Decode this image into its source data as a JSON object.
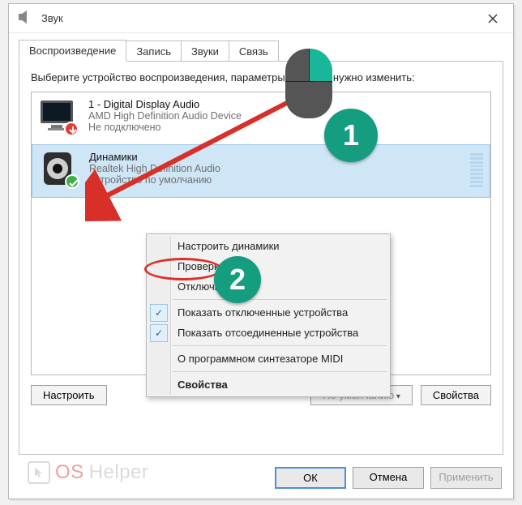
{
  "window": {
    "title": "Звук"
  },
  "tabs": [
    {
      "label": "Воспроизведение"
    },
    {
      "label": "Запись"
    },
    {
      "label": "Звуки"
    },
    {
      "label": "Связь"
    }
  ],
  "instruction": "Выберите устройство воспроизведения, параметры которого нужно изменить:",
  "devices": [
    {
      "name": "1 - Digital Display Audio",
      "driver": "AMD High Definition Audio Device",
      "status": "Не подключено",
      "state": "error"
    },
    {
      "name": "Динамики",
      "driver": "Realtek High Definition Audio",
      "status": "Устройство по умолчанию",
      "state": "default"
    }
  ],
  "context_menu": {
    "items": [
      {
        "label": "Настроить динамики",
        "type": "item"
      },
      {
        "label": "Проверка",
        "type": "item",
        "highlighted": true
      },
      {
        "label": "Отключить",
        "type": "item"
      },
      {
        "label": "Показать отключенные устройства",
        "type": "check",
        "checked": true
      },
      {
        "label": "Показать отсоединенные устройства",
        "type": "check",
        "checked": true
      },
      {
        "label": "О программном синтезаторе MIDI",
        "type": "item"
      },
      {
        "label": "Свойства",
        "type": "item",
        "bold": true
      }
    ]
  },
  "buttons": {
    "configure": "Настроить",
    "set_default": "По умолчанию",
    "properties": "Свойства",
    "ok": "ОК",
    "cancel": "Отмена",
    "apply": "Применить"
  },
  "annotations": {
    "step1": "1",
    "step2": "2"
  },
  "watermark": {
    "part1": "OS",
    "part2": "Helper"
  }
}
